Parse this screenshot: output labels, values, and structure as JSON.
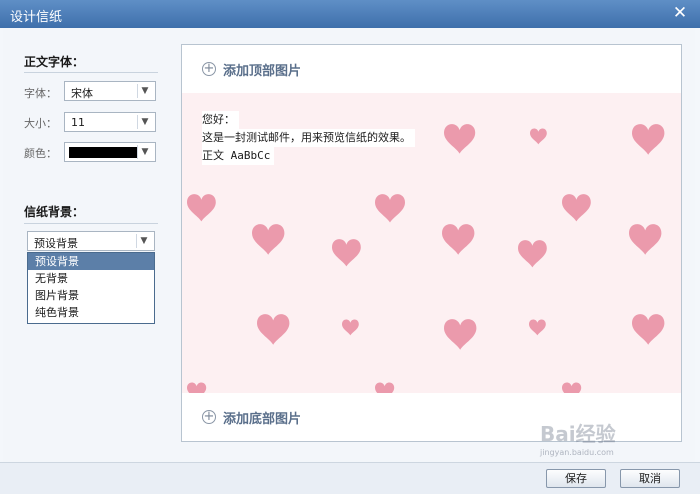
{
  "window": {
    "title": "设计信纸",
    "close_glyph": "✕"
  },
  "sidebar": {
    "font_section_title": "正文字体：",
    "font_label": "字体：",
    "font_value": "宋体",
    "size_label": "大小：",
    "size_value": "11",
    "color_label": "颜色：",
    "color_value": "#000000",
    "bg_section_title": "信纸背景：",
    "bg_value": "预设背景",
    "bg_options": [
      "预设背景",
      "无背景",
      "图片背景",
      "纯色背景"
    ],
    "bg_selected_index": 0
  },
  "preview": {
    "add_top_label": "添加顶部图片",
    "add_bottom_label": "添加底部图片",
    "letter_lines": [
      "您好：",
      "这是一封测试邮件，用来预览信纸的效果。",
      "正文 AaBbCc"
    ],
    "background_color": "#fdf0f2",
    "heart_color": "#eb9aac"
  },
  "footer": {
    "save_label": "保存",
    "cancel_label": "取消"
  },
  "watermark": {
    "text": "Bai经验",
    "sub_text": "jingyan.baidu.com"
  }
}
